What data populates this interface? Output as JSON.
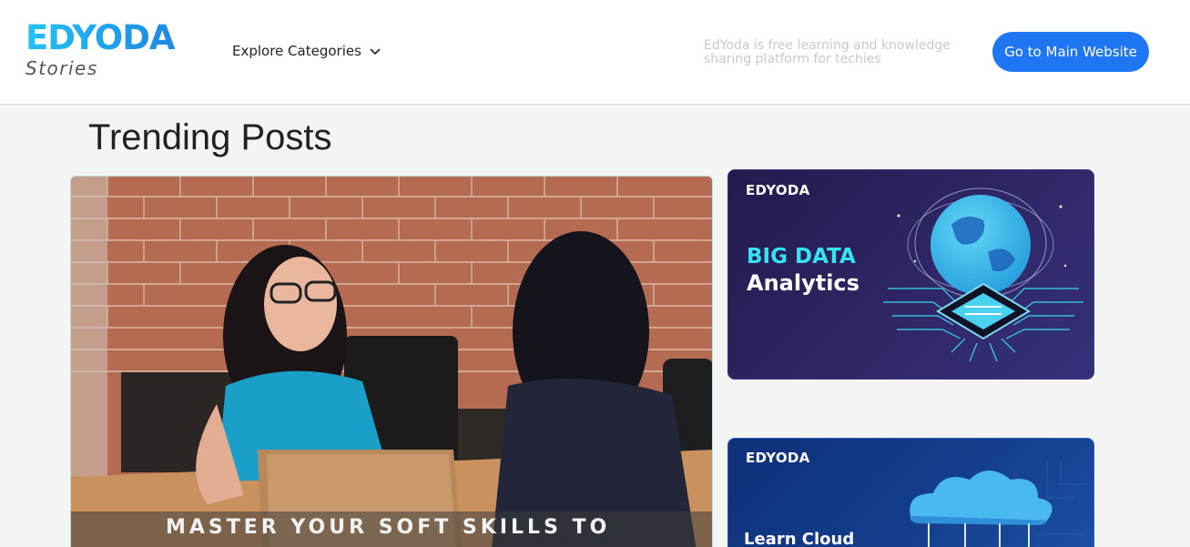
{
  "header": {
    "logo_main": "EDYODA",
    "logo_sub": "Stories",
    "explore_label": "Explore Categories",
    "tagline": "EdYoda is free learning and knowledge sharing platform for techies",
    "main_button_label": "Go to Main Website"
  },
  "trending": {
    "title": "Trending Posts",
    "featured": {
      "caption": "MASTER YOUR SOFT SKILLS TO"
    },
    "cards": [
      {
        "brand": "EDYODA",
        "title_line1": "BIG DATA",
        "title_line2": "Analytics"
      },
      {
        "brand": "EDYODA",
        "title_line1": "Learn Cloud"
      }
    ]
  },
  "colors": {
    "accent": "#1f76f2",
    "logo_cyan": "#22c3f2",
    "big_data_cyan": "#36e3f0"
  },
  "icons": [
    "chevron-down-icon",
    "globe-chip-illustration",
    "cloud-illustration"
  ]
}
